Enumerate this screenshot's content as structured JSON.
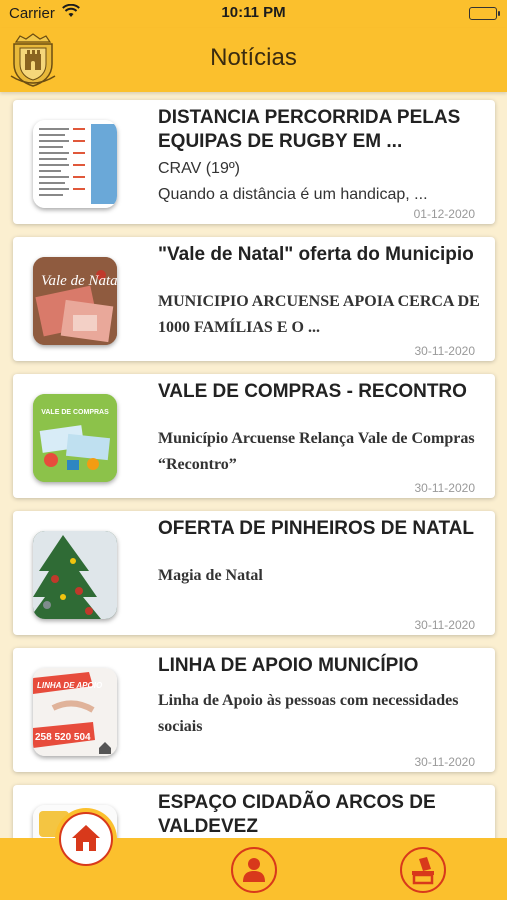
{
  "status": {
    "carrier": "Carrier",
    "time": "10:11 PM"
  },
  "header": {
    "title": "Notícias"
  },
  "news": [
    {
      "title": "DISTANCIA PERCORRIDA PELAS EQUIPAS DE RUGBY EM ...",
      "subtitle": "CRAV (19º)",
      "summary": "Quando a distância é um handicap, ...",
      "date": "01-12-2020"
    },
    {
      "title": "\"Vale de Natal\" oferta do Municipio",
      "summary": "MUNICIPIO ARCUENSE APOIA CERCA DE 1000 FAMÍLIAS E O ...",
      "date": "30-11-2020",
      "thumb_text": "Vale de Natal"
    },
    {
      "title": "VALE DE COMPRAS - RECONTRO",
      "summary": "Município Arcuense Relança Vale de Compras “Recontro”",
      "date": "30-11-2020",
      "thumb_text": "VALE DE COMPRAS"
    },
    {
      "title": "OFERTA DE PINHEIROS DE NATAL",
      "summary": "Magia de Natal",
      "date": "30-11-2020"
    },
    {
      "title": "LINHA DE APOIO MUNICÍPIO",
      "summary": "Linha de Apoio às pessoas com necessidades sociais",
      "date": "30-11-2020",
      "thumb_text": "LINHA DE APOIO",
      "thumb_phone": "258 520 504"
    },
    {
      "title": "ESPAÇO CIDADÃO ARCOS DE VALDEVEZ",
      "summary": "",
      "date": ""
    }
  ],
  "icons": {
    "home": "home-icon",
    "profile": "person-icon",
    "vote": "ballot-box-icon"
  },
  "colors": {
    "primary": "#fbc02d",
    "accent": "#d8391b",
    "background": "#fbefd0"
  }
}
